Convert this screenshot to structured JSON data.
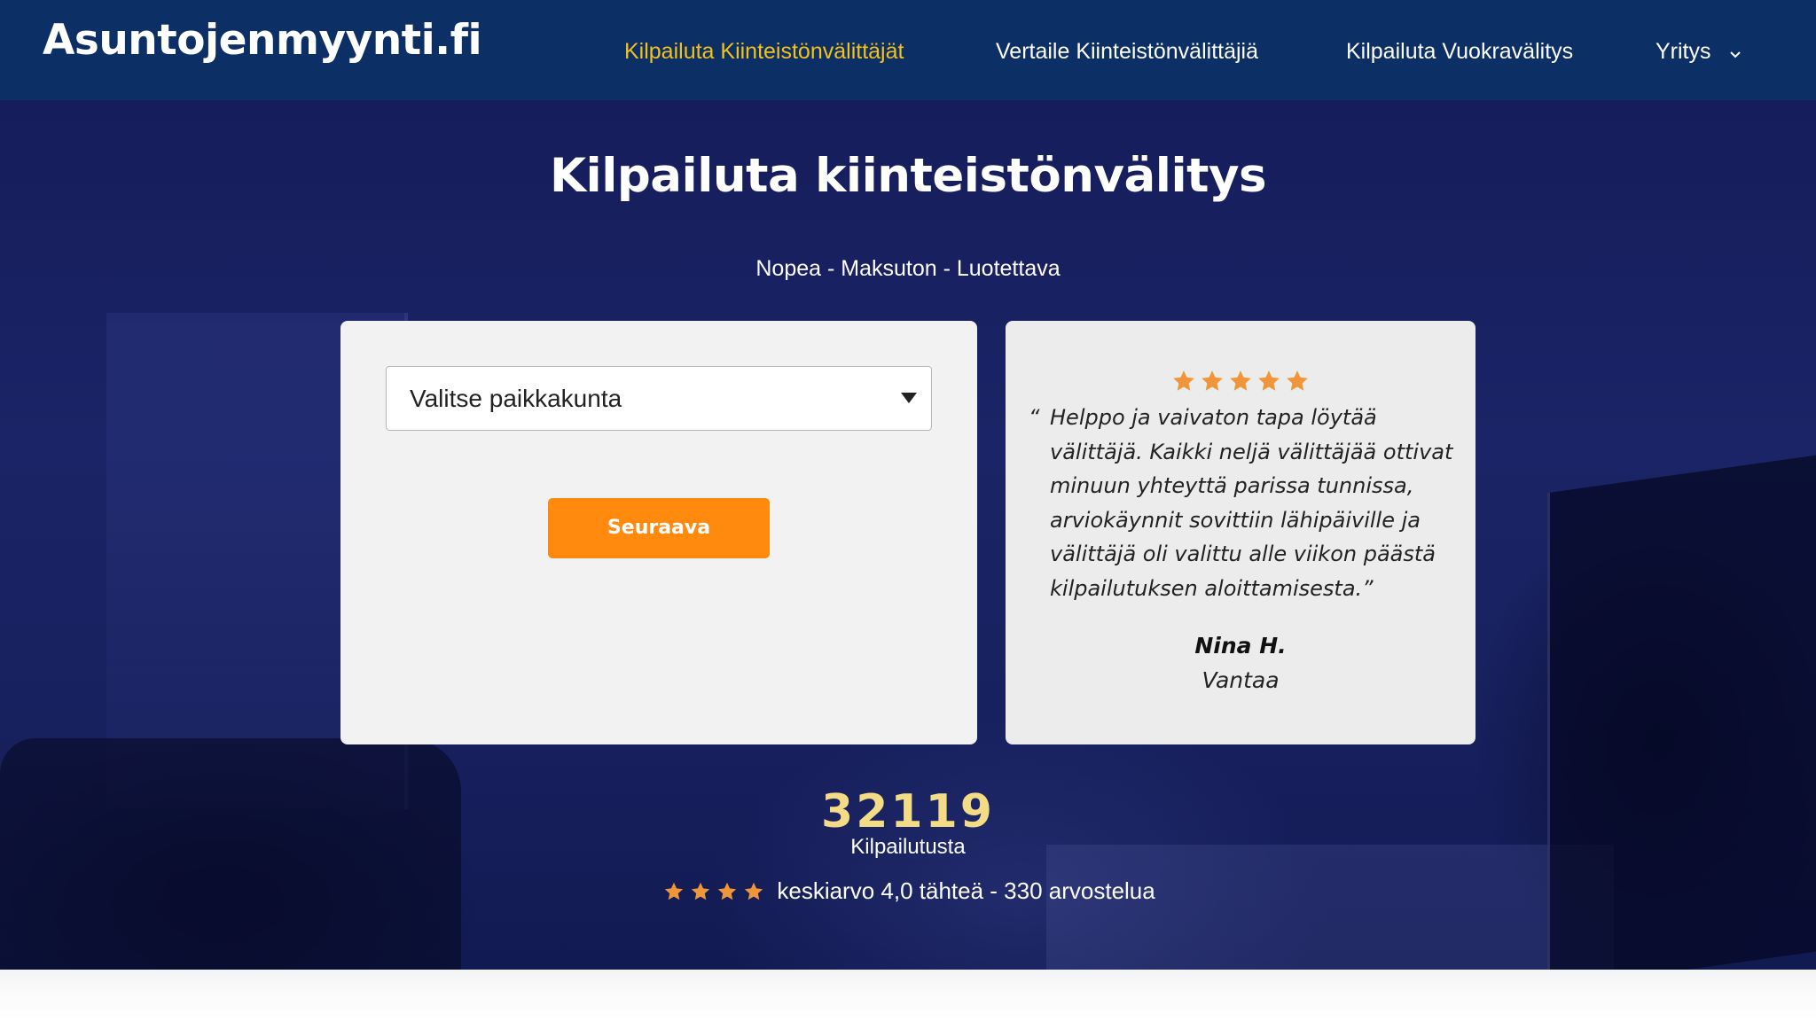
{
  "site": {
    "logo": "Asuntojenmyynti.fi"
  },
  "nav": {
    "items": [
      {
        "label": "Kilpailuta Kiinteistönvälittäjät",
        "active": true
      },
      {
        "label": "Vertaile Kiinteistönvälittäjiä",
        "active": false
      },
      {
        "label": "Kilpailuta Vuokravälitys",
        "active": false
      },
      {
        "label": "Yritys",
        "active": false,
        "dropdown": true
      }
    ]
  },
  "hero": {
    "title": "Kilpailuta kiinteistönvälitys",
    "subtitle": "Nopea - Maksuton - Luotettava"
  },
  "form": {
    "select_value": "Valitse paikkakunta",
    "next_label": "Seuraava"
  },
  "review": {
    "stars": 5,
    "open_quote": "“",
    "text": "Helppo ja vaivaton tapa löytää välittäjä. Kaikki neljä välittäjää ottivat minuun yhteyttä parissa tunnissa, arviokäynnit sovittiin lähipäiville ja välittäjä oli valittu alle viikon päästä kilpailutuksen aloittamisesta.",
    "close_quote": "”",
    "name": "Nina H.",
    "city": "Vantaa"
  },
  "stats": {
    "count": "32119",
    "count_label": "Kilpailutusta",
    "rating_stars": 4,
    "rating_text": "keskiarvo 4,0 tähteä - 330 arvostelua"
  },
  "colors": {
    "header_bg": "#0c2f66",
    "nav_active": "#f2c21b",
    "button": "#ff8a0e",
    "star": "#f0963a",
    "count": "#f4dc86"
  },
  "icons": {
    "nav_dropdown": "chevron-down-icon",
    "select_arrow": "caret-down-icon",
    "star": "star-icon"
  }
}
